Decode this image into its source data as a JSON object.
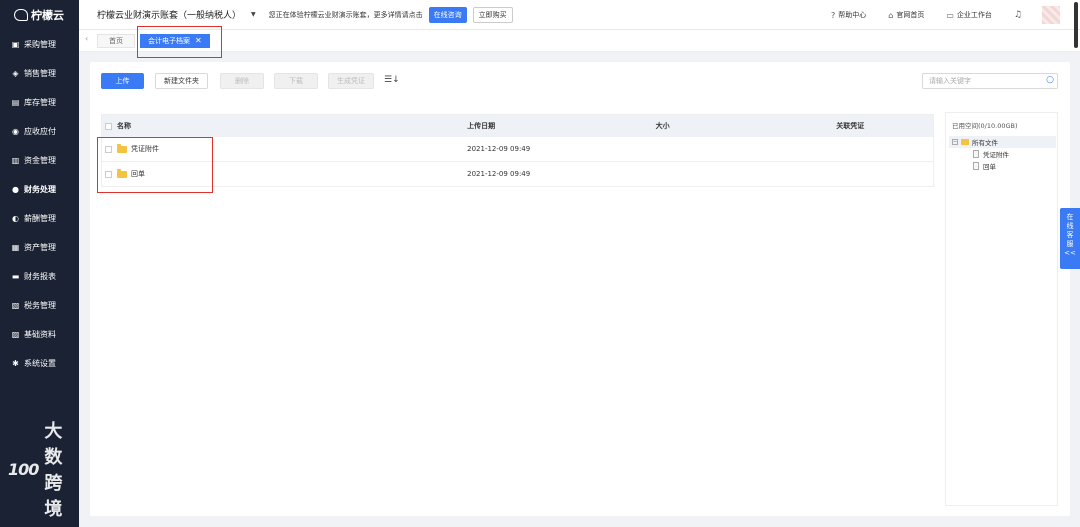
{
  "sidebar": {
    "logo": "柠檬云",
    "items": [
      {
        "label": "采购管理",
        "icon": "cart-icon"
      },
      {
        "label": "销售管理",
        "icon": "tag-icon"
      },
      {
        "label": "库存管理",
        "icon": "warehouse-icon"
      },
      {
        "label": "应收应付",
        "icon": "coin-icon"
      },
      {
        "label": "资金管理",
        "icon": "wallet-icon"
      },
      {
        "label": "财务处理",
        "icon": "finance-icon",
        "active": true
      },
      {
        "label": "薪酬管理",
        "icon": "salary-icon"
      },
      {
        "label": "资产管理",
        "icon": "asset-icon"
      },
      {
        "label": "财务报表",
        "icon": "report-icon"
      },
      {
        "label": "税务管理",
        "icon": "tax-icon"
      },
      {
        "label": "基础资料",
        "icon": "database-icon"
      },
      {
        "label": "系统设置",
        "icon": "gear-icon"
      }
    ]
  },
  "header": {
    "company": "柠檬云业财演示账套（一般纳税人）",
    "trial_text": "您正在体验柠檬云业财演示账套，更多详情请点击",
    "consult_label": "在线咨询",
    "buy_label": "立即购买",
    "help_label": "帮助中心",
    "site_label": "官网首页",
    "workbench_label": "企业工作台"
  },
  "tabs": {
    "home_label": "首页",
    "active_label": "会计电子档案"
  },
  "toolbar": {
    "upload_label": "上传",
    "new_folder_label": "新建文件夹",
    "delete_label": "删除",
    "download_label": "下载",
    "generate_label": "生成凭证",
    "search_placeholder": "请输入关键字"
  },
  "table": {
    "columns": [
      "名称",
      "上传日期",
      "大小",
      "关联凭证"
    ],
    "rows": [
      {
        "name": "凭证附件",
        "date": "2021-12-09 09:49",
        "size": "",
        "voucher": ""
      },
      {
        "name": "回单",
        "date": "2021-12-09 09:49",
        "size": "",
        "voucher": ""
      }
    ]
  },
  "tree": {
    "used_space": "已用空间(0/10.00GB)",
    "root_label": "所有文件",
    "children": [
      "凭证附件",
      "回单"
    ]
  },
  "side_service": {
    "label": "在线客服",
    "chars": [
      "在",
      "线",
      "客",
      "服"
    ],
    "arrow": "<<"
  },
  "watermark": {
    "logo": "100",
    "text": "大数跨境"
  },
  "colors": {
    "sidebar_bg": "#1a2233",
    "accent": "#3a7bf5",
    "highlight": "#e0312b"
  }
}
